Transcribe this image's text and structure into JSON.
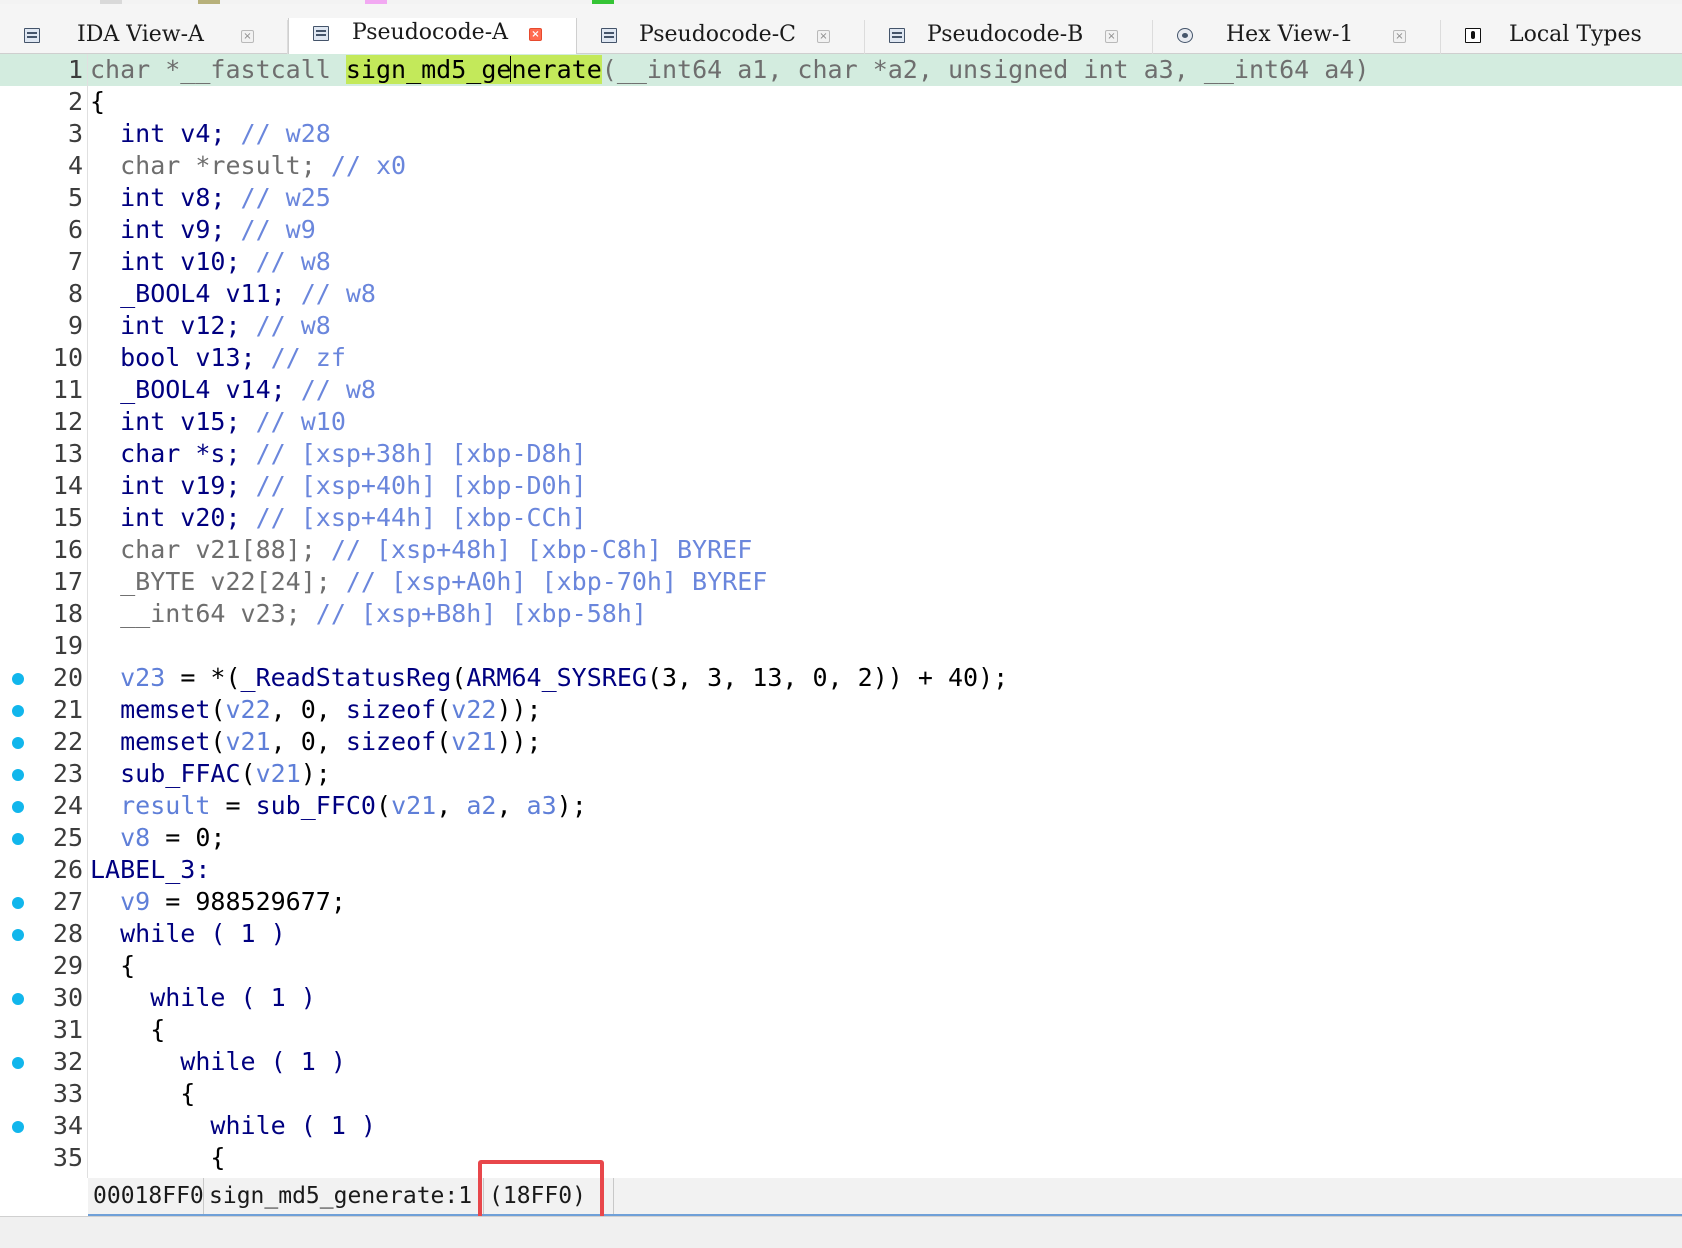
{
  "tabs": [
    {
      "label": "IDA View-A",
      "icon": "disassembly-view-icon",
      "active": false
    },
    {
      "label": "Pseudocode-A",
      "icon": "pseudocode-view-icon",
      "active": true
    },
    {
      "label": "Pseudocode-C",
      "icon": "pseudocode-view-icon",
      "active": false
    },
    {
      "label": "Pseudocode-B",
      "icon": "pseudocode-view-icon",
      "active": false
    },
    {
      "label": "Hex View-1",
      "icon": "hex-view-icon",
      "active": false
    },
    {
      "label": "Local Types",
      "icon": "local-types-icon",
      "active": false
    }
  ],
  "code": {
    "lines": [
      {
        "n": "1",
        "bp": false,
        "hl": true,
        "toks": [
          [
            "char *__fastcall ",
            "gray"
          ],
          [
            "sign_md5_ge",
            "sel"
          ],
          [
            "",
            "caret"
          ],
          [
            "nerate",
            "sel"
          ],
          [
            "(__int64 a1, char *a2, unsigned int a3, __int64 a4)",
            "gray"
          ]
        ]
      },
      {
        "n": "2",
        "bp": false,
        "toks": [
          [
            "{",
            "pl"
          ]
        ]
      },
      {
        "n": "3",
        "bp": false,
        "toks": [
          [
            "  int v4; ",
            "kw"
          ],
          [
            "// w28",
            "cmt"
          ]
        ]
      },
      {
        "n": "4",
        "bp": false,
        "toks": [
          [
            "  char *result; ",
            "gray"
          ],
          [
            "// x0",
            "cmt"
          ]
        ]
      },
      {
        "n": "5",
        "bp": false,
        "toks": [
          [
            "  int v8; ",
            "kw"
          ],
          [
            "// w25",
            "cmt"
          ]
        ]
      },
      {
        "n": "6",
        "bp": false,
        "toks": [
          [
            "  int v9; ",
            "kw"
          ],
          [
            "// w9",
            "cmt"
          ]
        ]
      },
      {
        "n": "7",
        "bp": false,
        "toks": [
          [
            "  int v10; ",
            "kw"
          ],
          [
            "// w8",
            "cmt"
          ]
        ]
      },
      {
        "n": "8",
        "bp": false,
        "toks": [
          [
            "  _BOOL4 v11; ",
            "kw"
          ],
          [
            "// w8",
            "cmt"
          ]
        ]
      },
      {
        "n": "9",
        "bp": false,
        "toks": [
          [
            "  int v12; ",
            "kw"
          ],
          [
            "// w8",
            "cmt"
          ]
        ]
      },
      {
        "n": "10",
        "bp": false,
        "toks": [
          [
            "  bool v13; ",
            "kw"
          ],
          [
            "// zf",
            "cmt"
          ]
        ]
      },
      {
        "n": "11",
        "bp": false,
        "toks": [
          [
            "  _BOOL4 v14; ",
            "kw"
          ],
          [
            "// w8",
            "cmt"
          ]
        ]
      },
      {
        "n": "12",
        "bp": false,
        "toks": [
          [
            "  int v15; ",
            "kw"
          ],
          [
            "// w10",
            "cmt"
          ]
        ]
      },
      {
        "n": "13",
        "bp": false,
        "toks": [
          [
            "  char *s; ",
            "kw"
          ],
          [
            "// [xsp+38h] [xbp-D8h]",
            "cmt"
          ]
        ]
      },
      {
        "n": "14",
        "bp": false,
        "toks": [
          [
            "  int v19; ",
            "kw"
          ],
          [
            "// [xsp+40h] [xbp-D0h]",
            "cmt"
          ]
        ]
      },
      {
        "n": "15",
        "bp": false,
        "toks": [
          [
            "  int v20; ",
            "kw"
          ],
          [
            "// [xsp+44h] [xbp-CCh]",
            "cmt"
          ]
        ]
      },
      {
        "n": "16",
        "bp": false,
        "toks": [
          [
            "  char v21[88]; ",
            "gray"
          ],
          [
            "// [xsp+48h] [xbp-C8h] BYREF",
            "cmt"
          ]
        ]
      },
      {
        "n": "17",
        "bp": false,
        "toks": [
          [
            "  _BYTE v22[24]; ",
            "gray"
          ],
          [
            "// [xsp+A0h] [xbp-70h] BYREF",
            "cmt"
          ]
        ]
      },
      {
        "n": "18",
        "bp": false,
        "toks": [
          [
            "  __int64 v23; ",
            "gray"
          ],
          [
            "// [xsp+B8h] [xbp-58h]",
            "cmt"
          ]
        ]
      },
      {
        "n": "19",
        "bp": false,
        "toks": []
      },
      {
        "n": "20",
        "bp": true,
        "toks": [
          [
            "  ",
            "pl"
          ],
          [
            "v23",
            "var"
          ],
          [
            " = *(",
            "pl"
          ],
          [
            "_ReadStatusReg",
            "fn"
          ],
          [
            "(",
            "pl"
          ],
          [
            "ARM64_SYSREG",
            "fn"
          ],
          [
            "(3, 3, 13, 0, 2)) + 40);",
            "pl"
          ]
        ]
      },
      {
        "n": "21",
        "bp": true,
        "toks": [
          [
            "  ",
            "pl"
          ],
          [
            "memset",
            "fn"
          ],
          [
            "(",
            "pl"
          ],
          [
            "v22",
            "var"
          ],
          [
            ", 0, ",
            "pl"
          ],
          [
            "sizeof",
            "kw"
          ],
          [
            "(",
            "pl"
          ],
          [
            "v22",
            "var"
          ],
          [
            "));",
            "pl"
          ]
        ]
      },
      {
        "n": "22",
        "bp": true,
        "toks": [
          [
            "  ",
            "pl"
          ],
          [
            "memset",
            "fn"
          ],
          [
            "(",
            "pl"
          ],
          [
            "v21",
            "var"
          ],
          [
            ", 0, ",
            "pl"
          ],
          [
            "sizeof",
            "kw"
          ],
          [
            "(",
            "pl"
          ],
          [
            "v21",
            "var"
          ],
          [
            "));",
            "pl"
          ]
        ]
      },
      {
        "n": "23",
        "bp": true,
        "toks": [
          [
            "  ",
            "pl"
          ],
          [
            "sub_FFAC",
            "fn"
          ],
          [
            "(",
            "pl"
          ],
          [
            "v21",
            "var"
          ],
          [
            ");",
            "pl"
          ]
        ]
      },
      {
        "n": "24",
        "bp": true,
        "toks": [
          [
            "  ",
            "pl"
          ],
          [
            "result",
            "var"
          ],
          [
            " = ",
            "pl"
          ],
          [
            "sub_FFC0",
            "fn"
          ],
          [
            "(",
            "pl"
          ],
          [
            "v21",
            "var"
          ],
          [
            ", ",
            "pl"
          ],
          [
            "a2",
            "var"
          ],
          [
            ", ",
            "pl"
          ],
          [
            "a3",
            "var"
          ],
          [
            ");",
            "pl"
          ]
        ]
      },
      {
        "n": "25",
        "bp": true,
        "toks": [
          [
            "  ",
            "pl"
          ],
          [
            "v8",
            "var"
          ],
          [
            " = 0;",
            "pl"
          ]
        ]
      },
      {
        "n": "26",
        "bp": false,
        "toks": [
          [
            "LABEL_3:",
            "kw"
          ]
        ]
      },
      {
        "n": "27",
        "bp": true,
        "toks": [
          [
            "  ",
            "pl"
          ],
          [
            "v9",
            "var"
          ],
          [
            " = 988529677;",
            "pl"
          ]
        ]
      },
      {
        "n": "28",
        "bp": true,
        "toks": [
          [
            "  while ( 1 )",
            "kw"
          ]
        ]
      },
      {
        "n": "29",
        "bp": false,
        "toks": [
          [
            "  {",
            "pl"
          ]
        ]
      },
      {
        "n": "30",
        "bp": true,
        "toks": [
          [
            "    while ( 1 )",
            "kw"
          ]
        ]
      },
      {
        "n": "31",
        "bp": false,
        "toks": [
          [
            "    {",
            "pl"
          ]
        ]
      },
      {
        "n": "32",
        "bp": true,
        "toks": [
          [
            "      while ( 1 )",
            "kw"
          ]
        ]
      },
      {
        "n": "33",
        "bp": false,
        "toks": [
          [
            "      {",
            "pl"
          ]
        ]
      },
      {
        "n": "34",
        "bp": true,
        "toks": [
          [
            "        while ( 1 )",
            "kw"
          ]
        ]
      },
      {
        "n": "35",
        "bp": false,
        "toks": [
          [
            "        {",
            "pl"
          ]
        ]
      }
    ]
  },
  "status": {
    "address": "00018FF0",
    "location": "sign_md5_generate:1",
    "ea": "(18FF0)"
  },
  "colors": {
    "current_line": "#d3ecdf",
    "identifier_highlight": "#c3e95a",
    "breakpoint_dot": "#11b6ec",
    "annotation_box": "#e8474b",
    "keyword": "#000080",
    "variable": "#5f7fd8",
    "comment": "#6a86dc",
    "declaration_gray": "#6e6e6e"
  }
}
